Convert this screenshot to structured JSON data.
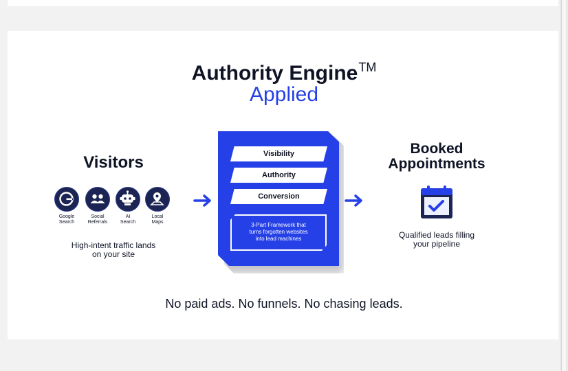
{
  "title": {
    "main": "Authority Engine",
    "tm": "TM",
    "sub": "Applied"
  },
  "visitors": {
    "heading": "Visitors",
    "sources": [
      {
        "label": "Google Search",
        "line1": "Google",
        "line2": "Search",
        "icon": "google-icon"
      },
      {
        "label": "Social Referrals",
        "line1": "Social",
        "line2": "Referrals",
        "icon": "people-icon"
      },
      {
        "label": "AI Search",
        "line1": "AI",
        "line2": "Search",
        "icon": "robot-icon"
      },
      {
        "label": "Local Maps",
        "line1": "Local",
        "line2": "Maps",
        "icon": "map-pin-icon"
      }
    ],
    "caption_line1": "High-intent traffic lands",
    "caption_line2": "on your site"
  },
  "engine": {
    "tiers": [
      "Visibility",
      "Authority",
      "Conversion"
    ],
    "framework_line1": "3-Part Framework that",
    "framework_line2": "turns forgotten websites",
    "framework_line3": "into lead machines"
  },
  "booked": {
    "heading_line1": "Booked",
    "heading_line2": "Appointments",
    "icon": "calendar-check-icon",
    "caption_line1": "Qualified leads filling",
    "caption_line2": "your pipeline"
  },
  "footer": "No paid ads. No funnels. No chasing leads.",
  "colors": {
    "accent": "#2440e6",
    "dark": "#0f1324",
    "icon_bg": "#1b2452"
  }
}
